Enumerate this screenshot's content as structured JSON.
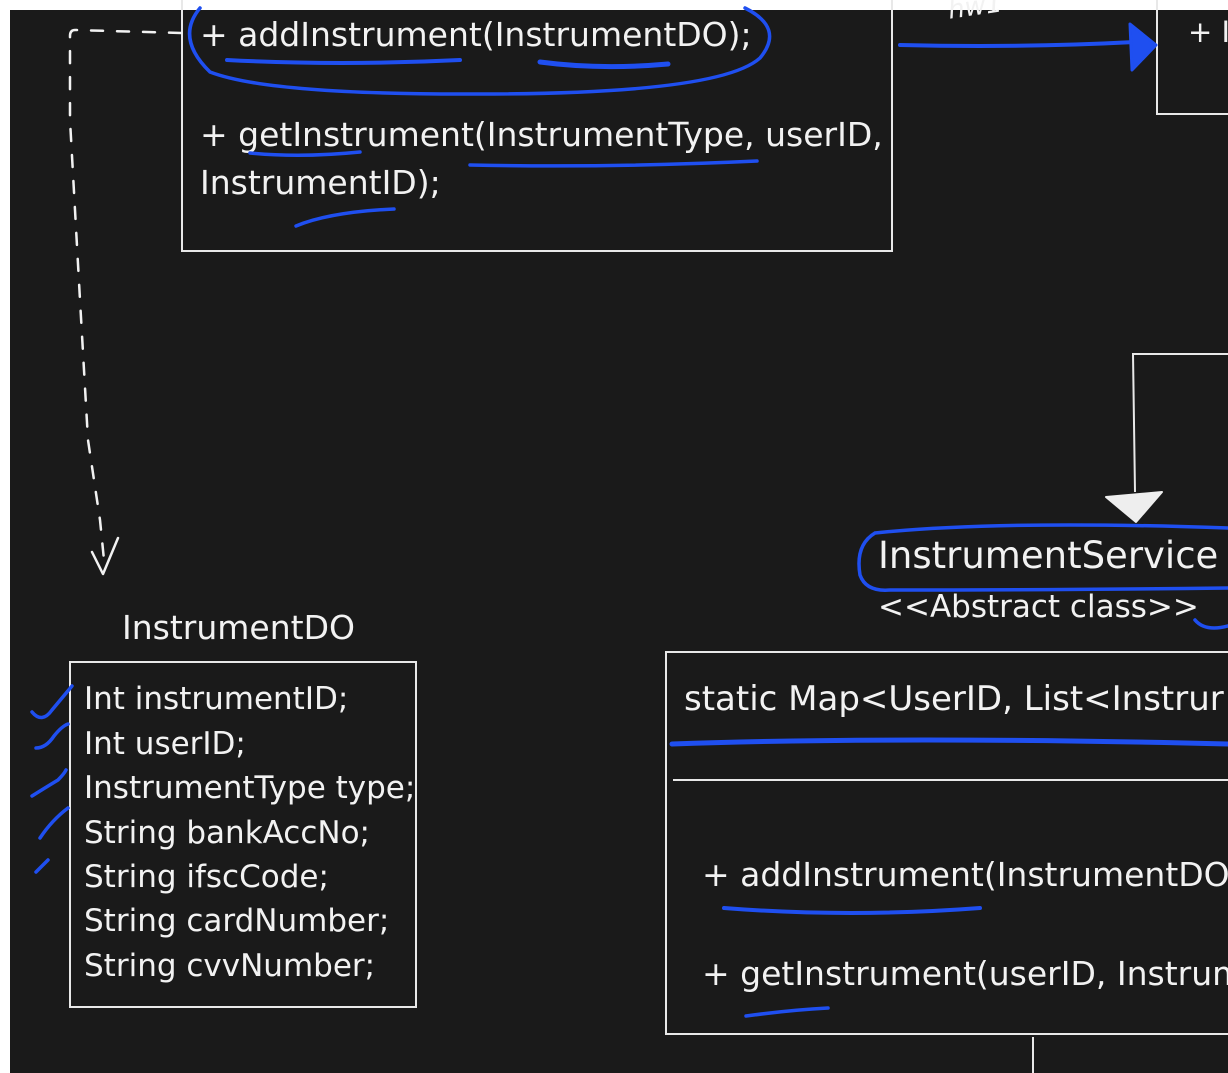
{
  "top_class": {
    "add_method": "+ addInstrument(InstrumentDO);",
    "get_method_line1": "+ getInstrument(InstrumentType, userID,",
    "get_method_line2": "InstrumentID);"
  },
  "right_class_partial": {
    "method_fragment": "+ I"
  },
  "handwritten_note": "hw1",
  "instrument_do": {
    "title": "InstrumentDO",
    "fields": [
      "Int instrumentID;",
      "Int userID;",
      "InstrumentType type;",
      "String bankAccNo;",
      "String ifscCode;",
      "String cardNumber;",
      "String cvvNumber;"
    ]
  },
  "instrument_service": {
    "title": "InstrumentService",
    "stereotype": "<<Abstract class>>",
    "attribute": "static Map<UserID, List<Instrur",
    "add_method": "+ addInstrument(InstrumentDO);",
    "get_method": "+ getInstrument(userID, Instrume"
  },
  "colors": {
    "background": "#1a1a1a",
    "foreground": "#f2f2f2",
    "annotation_blue": "#1f4ff0"
  }
}
